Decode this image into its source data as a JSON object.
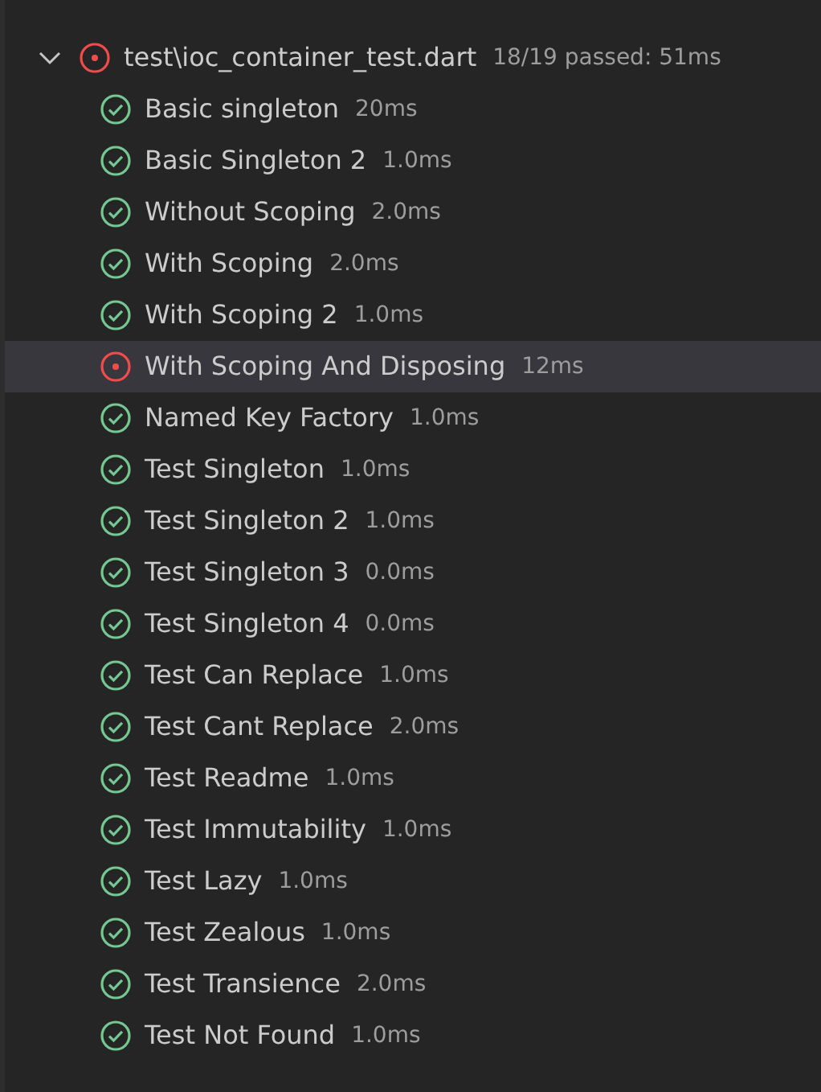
{
  "file": {
    "name": "test\\ioc_container_test.dart",
    "summary": "18/19 passed: 51ms",
    "expanded": true,
    "kind": "failed"
  },
  "tests": [
    {
      "name": "Basic singleton",
      "duration": "20ms",
      "kind": "passed",
      "selected": false
    },
    {
      "name": "Basic Singleton 2",
      "duration": "1.0ms",
      "kind": "passed",
      "selected": false
    },
    {
      "name": "Without Scoping",
      "duration": "2.0ms",
      "kind": "passed",
      "selected": false
    },
    {
      "name": "With Scoping",
      "duration": "2.0ms",
      "kind": "passed",
      "selected": false
    },
    {
      "name": "With Scoping 2",
      "duration": "1.0ms",
      "kind": "passed",
      "selected": false
    },
    {
      "name": "With Scoping And Disposing",
      "duration": "12ms",
      "kind": "failed",
      "selected": true
    },
    {
      "name": "Named Key Factory",
      "duration": "1.0ms",
      "kind": "passed",
      "selected": false
    },
    {
      "name": "Test Singleton",
      "duration": "1.0ms",
      "kind": "passed",
      "selected": false
    },
    {
      "name": "Test Singleton 2",
      "duration": "1.0ms",
      "kind": "passed",
      "selected": false
    },
    {
      "name": "Test Singleton 3",
      "duration": "0.0ms",
      "kind": "passed",
      "selected": false
    },
    {
      "name": "Test Singleton 4",
      "duration": "0.0ms",
      "kind": "passed",
      "selected": false
    },
    {
      "name": "Test Can Replace",
      "duration": "1.0ms",
      "kind": "passed",
      "selected": false
    },
    {
      "name": "Test Cant Replace",
      "duration": "2.0ms",
      "kind": "passed",
      "selected": false
    },
    {
      "name": "Test Readme",
      "duration": "1.0ms",
      "kind": "passed",
      "selected": false
    },
    {
      "name": "Test Immutability",
      "duration": "1.0ms",
      "kind": "passed",
      "selected": false
    },
    {
      "name": "Test Lazy",
      "duration": "1.0ms",
      "kind": "passed",
      "selected": false
    },
    {
      "name": "Test Zealous",
      "duration": "1.0ms",
      "kind": "passed",
      "selected": false
    },
    {
      "name": "Test Transience",
      "duration": "2.0ms",
      "kind": "passed",
      "selected": false
    },
    {
      "name": "Test Not Found",
      "duration": "1.0ms",
      "kind": "passed",
      "selected": false
    }
  ]
}
